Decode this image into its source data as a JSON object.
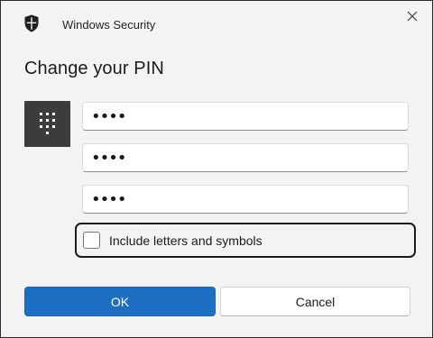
{
  "window": {
    "app_title": "Windows Security",
    "app_icon": "shield-icon",
    "close_icon": "close-icon"
  },
  "dialog": {
    "heading": "Change your PIN",
    "keypad_icon": "pin-keypad-icon",
    "pin_fields": [
      {
        "value": "••••"
      },
      {
        "value": "••••"
      },
      {
        "value": "••••"
      }
    ],
    "include_letters": {
      "label": "Include letters and symbols",
      "checked": false
    },
    "ok_label": "OK",
    "cancel_label": "Cancel"
  },
  "colors": {
    "accent": "#1e6fc4",
    "background": "#f3f3f3"
  }
}
